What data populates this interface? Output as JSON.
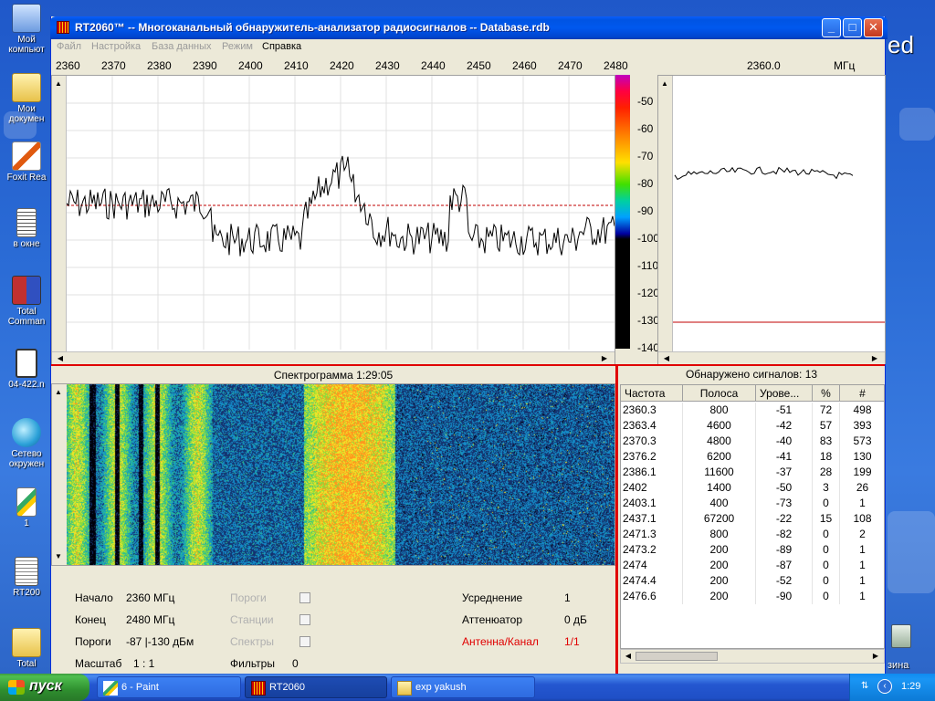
{
  "desktop": {
    "icons": [
      {
        "label": "Мой\nкомпьют"
      },
      {
        "label": "Мои\nдокумен"
      },
      {
        "label": "Foxit Rea"
      },
      {
        "label": "в окне"
      },
      {
        "label": "Total\nComman"
      },
      {
        "label": "04-422.n"
      },
      {
        "label": "Сетево\nокружен"
      },
      {
        "label": "1"
      },
      {
        "label": "RT200"
      },
      {
        "label": "Total"
      }
    ],
    "right_fragments": {
      "top": "ed",
      "bottom": "зина"
    }
  },
  "window": {
    "title": "RT2060™ -- Многоканальный обнаружитель-анализатор радиосигналов -- Database.rdb",
    "buttons": {
      "minimize": "_",
      "maximize": "□",
      "close": "✕"
    }
  },
  "menu": [
    {
      "label": "Файл",
      "enabled": false
    },
    {
      "label": "Настройка",
      "enabled": false
    },
    {
      "label": "База данных",
      "enabled": false
    },
    {
      "label": "Режим",
      "enabled": false
    },
    {
      "label": "Справка",
      "enabled": true
    }
  ],
  "freq_axis": {
    "ticks": [
      "2360",
      "2370",
      "2380",
      "2390",
      "2400",
      "2410",
      "2420",
      "2430",
      "2440",
      "2450",
      "2460",
      "2470",
      "2480"
    ],
    "cursor_value": "2360.0",
    "unit": "МГц"
  },
  "db_scale": [
    "-50",
    "-60",
    "-70",
    "-80",
    "-90",
    "-100",
    "-110",
    "-120",
    "-130",
    "-140"
  ],
  "spectrogram": {
    "title": "Спектрограмма 1:29:05"
  },
  "settings": {
    "start_label": "Начало",
    "start_value": "2360 МГц",
    "end_label": "Конец",
    "end_value": "2480 МГц",
    "thresholds_label": "Пороги",
    "thresholds_value": "-87 |-130 дБм",
    "scale_label": "Масштаб",
    "scale_value": "1 : 1",
    "opt_thresholds": "Пороги",
    "opt_stations": "Станции",
    "opt_spectra": "Спектры",
    "filters_label": "Фильтры",
    "filters_value": "0",
    "averaging_label": "Усреднение",
    "averaging_value": "1",
    "attenuator_label": "Аттенюатор",
    "attenuator_value": "0 дБ",
    "antenna_label": "Антенна/Канал",
    "antenna_value": "1/1"
  },
  "signals": {
    "title": "Обнаружено сигналов: 13",
    "columns": [
      "Частота",
      "Полоса",
      "Урове...",
      "%",
      "#"
    ],
    "rows": [
      [
        "2360.3",
        "800",
        "-51",
        "72",
        "498"
      ],
      [
        "2363.4",
        "4600",
        "-42",
        "57",
        "393"
      ],
      [
        "2370.3",
        "4800",
        "-40",
        "83",
        "573"
      ],
      [
        "2376.2",
        "6200",
        "-41",
        "18",
        "130"
      ],
      [
        "2386.1",
        "11600",
        "-37",
        "28",
        "199"
      ],
      [
        "2402",
        "1400",
        "-50",
        "3",
        "26"
      ],
      [
        "2403.1",
        "400",
        "-73",
        "0",
        "1"
      ],
      [
        "2437.1",
        "67200",
        "-22",
        "15",
        "108"
      ],
      [
        "2471.3",
        "800",
        "-82",
        "0",
        "2"
      ],
      [
        "2473.2",
        "200",
        "-89",
        "0",
        "1"
      ],
      [
        "2474",
        "200",
        "-87",
        "0",
        "1"
      ],
      [
        "2474.4",
        "200",
        "-52",
        "0",
        "1"
      ],
      [
        "2476.6",
        "200",
        "-90",
        "0",
        "1"
      ]
    ]
  },
  "taskbar": {
    "start_label": "пуск",
    "tasks": [
      "6 - Paint",
      "RT2060",
      "exp yakush"
    ],
    "clock": "1:29"
  },
  "colors": {
    "accent_red": "#e00000",
    "title_blue": "#0054e3",
    "threshold_line": "#c00000"
  }
}
